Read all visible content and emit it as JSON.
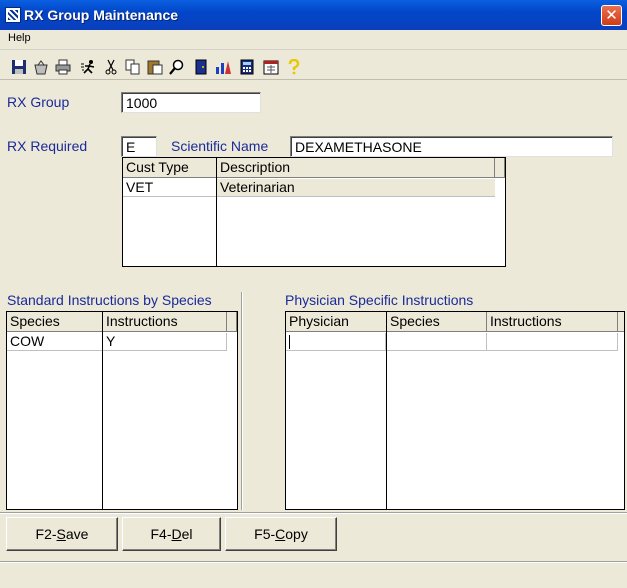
{
  "window": {
    "title": "RX Group Maintenance",
    "close_glyph": "✕"
  },
  "menu": {
    "items": [
      "Help"
    ]
  },
  "toolbar": {
    "buttons": [
      "save-icon",
      "basket-icon",
      "print-icon",
      "run-icon",
      "cut-icon",
      "copy-icon",
      "paste-icon",
      "find-icon",
      "exit-door-icon",
      "chart-icon",
      "calculator-icon",
      "calendar-icon",
      "help-icon"
    ]
  },
  "form": {
    "rx_group_label": "RX Group",
    "rx_group_value": "1000",
    "rx_required_label": "RX Required",
    "rx_required_value": "E",
    "scientific_name_label": "Scientific Name",
    "scientific_name_value": "DEXAMETHASONE"
  },
  "cust_grid": {
    "headers": [
      "Cust Type",
      "Description"
    ],
    "rows": [
      [
        "VET",
        "Veterinarian"
      ]
    ]
  },
  "species_section": {
    "title": "Standard Instructions by Species",
    "headers": [
      "Species",
      "Instructions"
    ],
    "rows": [
      [
        "COW",
        "Y"
      ]
    ]
  },
  "physician_section": {
    "title": "Physician Specific Instructions",
    "headers": [
      "Physician",
      "Species",
      "Instructions"
    ],
    "rows": [
      [
        "",
        "",
        ""
      ]
    ]
  },
  "buttons": {
    "save": {
      "key": "F2-",
      "mnemonic": "S",
      "rest": "ave"
    },
    "delete": {
      "key": "F4-",
      "mnemonic": "D",
      "rest": "el"
    },
    "copy": {
      "key": "F5-",
      "mnemonic": "C",
      "rest": "opy"
    }
  }
}
